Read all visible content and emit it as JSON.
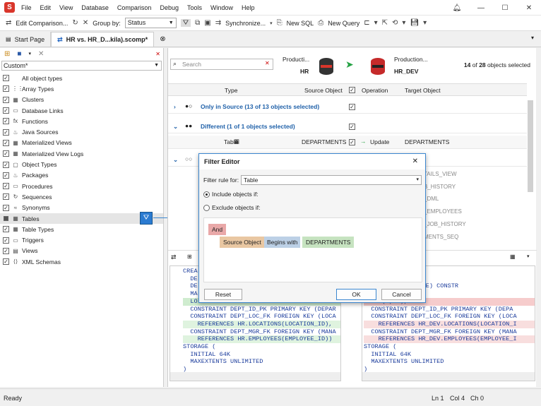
{
  "app": {
    "logo": "S",
    "menu": [
      "File",
      "Edit",
      "View",
      "Database",
      "Comparison",
      "Debug",
      "Tools",
      "Window",
      "Help"
    ],
    "win": {
      "min": "—",
      "max": "☐",
      "close": "✕"
    },
    "notify_icon": "bell-icon"
  },
  "toolbar": {
    "edit_comparison": "Edit Comparison...",
    "group_by_label": "Group by:",
    "group_by_value": "Status",
    "synchronize": "Synchronize...",
    "new_sql": "New SQL",
    "new_query": "New Query"
  },
  "tabs": [
    {
      "label": "Start Page"
    },
    {
      "label": "HR vs. HR_D...kila).scomp*"
    }
  ],
  "left": {
    "combo": "Custom*",
    "items": [
      {
        "label": "All object types",
        "checked": true,
        "icon": ""
      },
      {
        "label": "Array Types",
        "checked": true,
        "icon": "⋮⋮"
      },
      {
        "label": "Clusters",
        "checked": true,
        "icon": "▦"
      },
      {
        "label": "Database Links",
        "checked": true,
        "icon": "▭"
      },
      {
        "label": "Functions",
        "checked": true,
        "icon": "fx"
      },
      {
        "label": "Java Sources",
        "checked": true,
        "icon": "♨"
      },
      {
        "label": "Materialized Views",
        "checked": true,
        "icon": "▦"
      },
      {
        "label": "Materialized View Logs",
        "checked": true,
        "icon": "▦"
      },
      {
        "label": "Object Types",
        "checked": true,
        "icon": "▢"
      },
      {
        "label": "Packages",
        "checked": true,
        "icon": "♨"
      },
      {
        "label": "Procedures",
        "checked": true,
        "icon": "▭"
      },
      {
        "label": "Sequences",
        "checked": true,
        "icon": "↻"
      },
      {
        "label": "Synonyms",
        "checked": true,
        "icon": "≈"
      },
      {
        "label": "Tables",
        "checked": "partial",
        "icon": "▦"
      },
      {
        "label": "Table Types",
        "checked": true,
        "icon": "▦"
      },
      {
        "label": "Triggers",
        "checked": true,
        "icon": "▭"
      },
      {
        "label": "Views",
        "checked": true,
        "icon": "▤"
      },
      {
        "label": "XML Schemas",
        "checked": true,
        "icon": "⟨⟩"
      }
    ]
  },
  "main": {
    "search_placeholder": "Search",
    "source_conn": "Producti...",
    "source_db": "HR",
    "target_conn": "Production...",
    "target_db": "HR_DEV",
    "count_prefix": "14",
    "count_mid": " of ",
    "count_total": "28",
    "count_suffix": " objects selected",
    "cols": {
      "type": "Type",
      "source": "Source Object",
      "operation": "Operation",
      "target": "Target Object"
    },
    "group1": "Only in Source (13 of 13 objects selected)",
    "group2": "Different (1 of 1 objects selected)",
    "row_type": "Table",
    "row_source": "DEPARTMENTS",
    "row_op": "Update",
    "row_target": "DEPARTMENTS",
    "bg_rows": [
      "TAILS_VIEW",
      "B_HISTORY",
      "_DML",
      "_EMPLOYEES",
      "_JOB_HISTORY",
      "MENTS_SEQ"
    ]
  },
  "dialog": {
    "title": "Filter Editor",
    "rule_label": "Filter rule for:",
    "rule_value": "Table",
    "include": "Include objects if:",
    "exclude": "Exclude objects if:",
    "op": "And",
    "cond_field": "Source Object",
    "cond_op": "Begins with",
    "cond_val": "DEPARTMENTS",
    "reset": "Reset",
    "ok": "OK",
    "cancel": "Cancel"
  },
  "code_left": [
    "CREA",
    "  DE",
    "  DE",
    "  MA",
    "  LO",
    "  CONSTRAINT DEPT_ID_PK PRIMARY KEY (DEPAR",
    "  CONSTRAINT DEPT_LOC_FK FOREIGN KEY (LOCA",
    "    REFERENCES HR.LOCATIONS(LOCATION_ID),",
    "  CONSTRAINT DEPT_MGR_FK FOREIGN KEY (MANA",
    "    REFERENCES HR.EMPLOYEES(EMPLOYEE_ID))",
    "STORAGE (",
    "  INITIAL 64K",
    "  MAXEXTENTS UNLIMITED",
    ")"
  ],
  "code_right": [
    "ARTMENTS (",
    "UMBER(4, 0),",
    "  VARCHAR2(30 BYTE) CONSTR",
    "ER(6, 0),",
    "UMBER(4, 0),",
    "  CONSTRAINT DEPT_ID_PK PRIMARY KEY (DEPA",
    "  CONSTRAINT DEPT_LOC_FK FOREIGN KEY (LOCA",
    "    REFERENCES HR_DEV.LOCATIONS(LOCATION_I",
    "  CONSTRAINT DEPT_MGR_FK FOREIGN KEY (MANA",
    "    REFERENCES HR_DEV.EMPLOYEES(EMPLOYEE_I",
    "STORAGE (",
    "  INITIAL 64K",
    "  MAXEXTENTS UNLIMITED",
    ")"
  ],
  "status": {
    "ready": "Ready",
    "ln": "Ln 1",
    "col": "Col 4",
    "ch": "Ch 0"
  }
}
